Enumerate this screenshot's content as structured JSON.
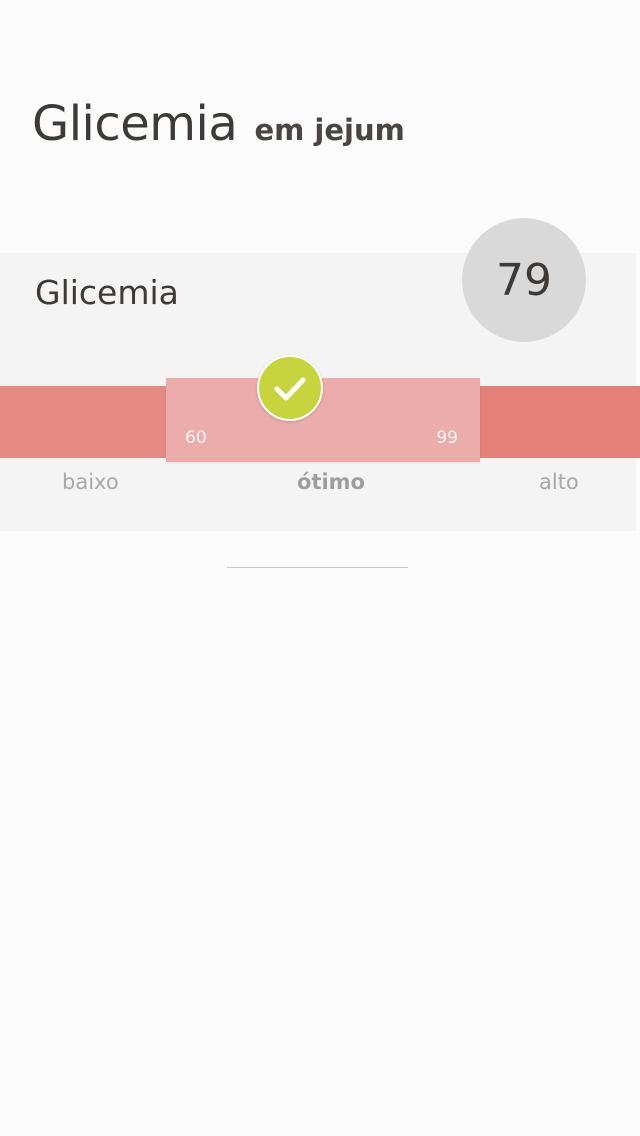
{
  "header": {
    "title": "Glicemia",
    "subtitle": "em jejum"
  },
  "metric": {
    "label": "Glicemia",
    "value": "79"
  },
  "range": {
    "min": "60",
    "max": "99",
    "zones": {
      "low": "baixo",
      "optimal": "ótimo",
      "high": "alto"
    },
    "status": "optimal"
  },
  "colors": {
    "low_zone": "#e48a82",
    "high_zone": "#e48077",
    "optimal_zone": "#ecacab",
    "check_badge": "#c8d43e",
    "value_circle": "#d9d9d9"
  },
  "icons": {
    "status": "checkmark-icon"
  }
}
